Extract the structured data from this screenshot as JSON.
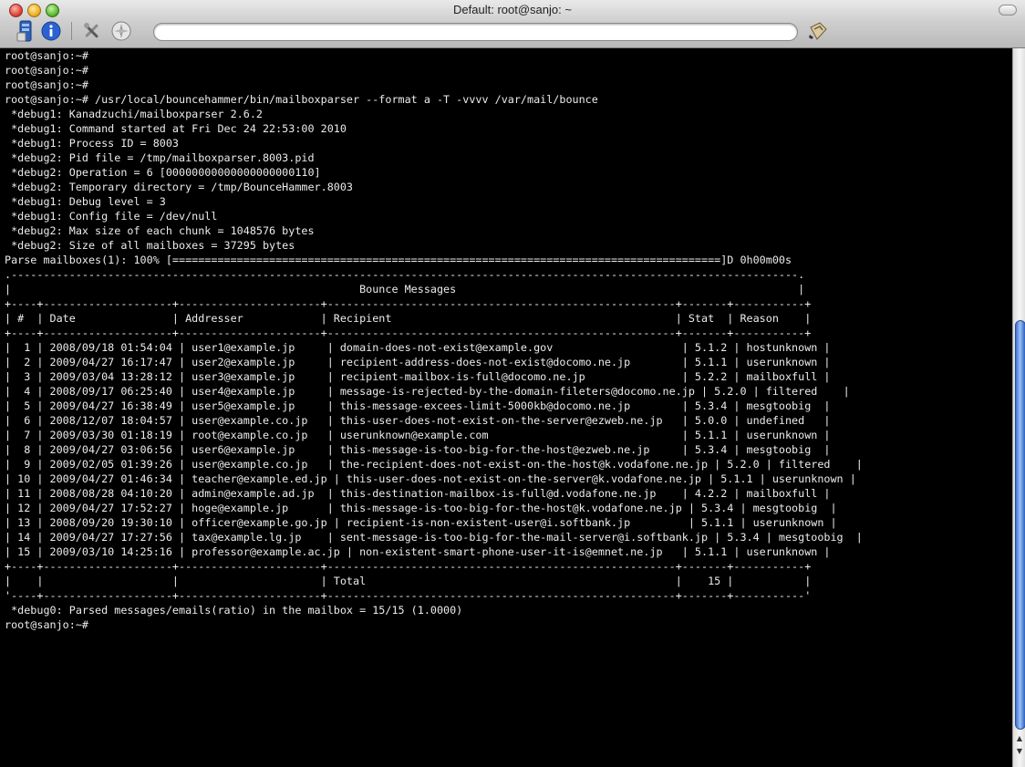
{
  "window": {
    "title": "Default: root@sanjo: ~"
  },
  "toolbar": {
    "url_value": ""
  },
  "terminal": {
    "lines": [
      "root@sanjo:~#",
      "root@sanjo:~#",
      "root@sanjo:~#",
      "root@sanjo:~# /usr/local/bouncehammer/bin/mailboxparser --format a -T -vvvv /var/mail/bounce",
      " *debug1: Kanadzuchi/mailboxparser 2.6.2",
      " *debug1: Command started at Fri Dec 24 22:53:00 2010",
      " *debug1: Process ID = 8003",
      " *debug2: Pid file = /tmp/mailboxparser.8003.pid",
      " *debug2: Operation = 6 [00000000000000000000110]",
      " *debug2: Temporary directory = /tmp/BounceHammer.8003",
      " *debug1: Debug level = 3",
      " *debug1: Config file = /dev/null",
      " *debug2: Max size of each chunk = 1048576 bytes",
      " *debug2: Size of all mailboxes = 37295 bytes",
      "Parse mailboxes(1): 100% [=====================================================================================]D 0h00m00s",
      ".--------------------------------------------------------------------------------------------------------------------------.",
      "|                                                      Bounce Messages                                                     |",
      "+----+--------------------+----------------------+------------------------------------------------------+-------+-----------+",
      "| #  | Date               | Addresser            | Recipient                                            | Stat  | Reason    |",
      "+----+--------------------+----------------------+------------------------------------------------------+-------+-----------+",
      "|  1 | 2008/09/18 01:54:04 | user1@example.jp     | domain-does-not-exist@example.gov                    | 5.1.2 | hostunknown |",
      "|  2 | 2009/04/27 16:17:47 | user2@example.jp     | recipient-address-does-not-exist@docomo.ne.jp        | 5.1.1 | userunknown |",
      "|  3 | 2009/03/04 13:28:12 | user3@example.jp     | recipient-mailbox-is-full@docomo.ne.jp               | 5.2.2 | mailboxfull |",
      "|  4 | 2008/09/17 06:25:40 | user4@example.jp     | message-is-rejected-by-the-domain-fileters@docomo.ne.jp | 5.2.0 | filtered    |",
      "|  5 | 2009/04/27 16:38:49 | user5@example.jp     | this-message-excees-limit-5000kb@docomo.ne.jp        | 5.3.4 | mesgtoobig  |",
      "|  6 | 2008/12/07 18:04:57 | user@example.co.jp   | this-user-does-not-exist-on-the-server@ezweb.ne.jp   | 5.0.0 | undefined   |",
      "|  7 | 2009/03/30 01:18:19 | root@example.co.jp   | userunknown@example.com                              | 5.1.1 | userunknown |",
      "|  8 | 2009/04/27 03:06:56 | user6@example.jp     | this-message-is-too-big-for-the-host@ezweb.ne.jp     | 5.3.4 | mesgtoobig  |",
      "|  9 | 2009/02/05 01:39:26 | user@example.co.jp   | the-recipient-does-not-exist-on-the-host@k.vodafone.ne.jp | 5.2.0 | filtered    |",
      "| 10 | 2009/04/27 01:46:34 | teacher@example.ed.jp | this-user-does-not-exist-on-the-server@k.vodafone.ne.jp | 5.1.1 | userunknown |",
      "| 11 | 2008/08/28 04:10:20 | admin@example.ad.jp  | this-destination-mailbox-is-full@d.vodafone.ne.jp    | 4.2.2 | mailboxfull |",
      "| 12 | 2009/04/27 17:52:27 | hoge@example.jp      | this-message-is-too-big-for-the-host@k.vodafone.ne.jp | 5.3.4 | mesgtoobig  |",
      "| 13 | 2008/09/20 19:30:10 | officer@example.go.jp | recipient-is-non-existent-user@i.softbank.jp         | 5.1.1 | userunknown |",
      "| 14 | 2009/04/27 17:27:56 | tax@example.lg.jp    | sent-message-is-too-big-for-the-mail-server@i.softbank.jp | 5.3.4 | mesgtoobig  |",
      "| 15 | 2009/03/10 14:25:16 | professor@example.ac.jp | non-existent-smart-phone-user-it-is@emnet.ne.jp   | 5.1.1 | userunknown |",
      "+----+--------------------+----------------------+------------------------------------------------------+-------+-----------+",
      "|    |                    |                      | Total                                                |    15 |           |",
      "'----+--------------------+----------------------+------------------------------------------------------+-------+-----------'",
      " *debug0: Parsed messages/emails(ratio) in the mailbox = 15/15 (1.0000)",
      "root@sanjo:~#"
    ]
  },
  "scrollbar": {
    "up_arrow": "▲",
    "down_arrow": "▼"
  }
}
